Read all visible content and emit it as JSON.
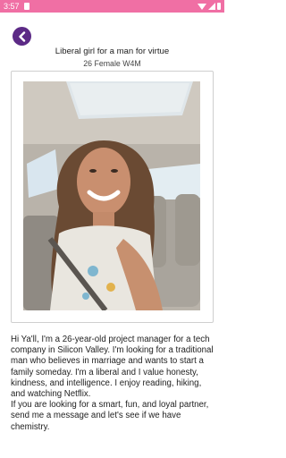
{
  "status_bar": {
    "time": "3:57",
    "background_color": "#f06fa4",
    "icons": [
      "notification-icon",
      "wifi-icon",
      "signal-icon",
      "battery-icon"
    ]
  },
  "header": {
    "back_icon": "chevron-left-icon",
    "back_button_color": "#5c2a86",
    "title": "Liberal girl for a man for virtue",
    "subtitle": "26 Female W4M"
  },
  "photo": {
    "subject": "profile-photo"
  },
  "bio": {
    "paragraphs": [
      "Hi Ya'll, I'm a 26-year-old project manager for a tech company in Silicon Valley. I'm looking for a traditional man who believes in marriage and wants to start a family someday. I'm a liberal and I value honesty, kindness, and intelligence. I enjoy reading, hiking, and watching Netflix.",
      "If you are looking for a smart, fun, and loyal partner, send me a message and let's see if we have chemistry."
    ]
  }
}
